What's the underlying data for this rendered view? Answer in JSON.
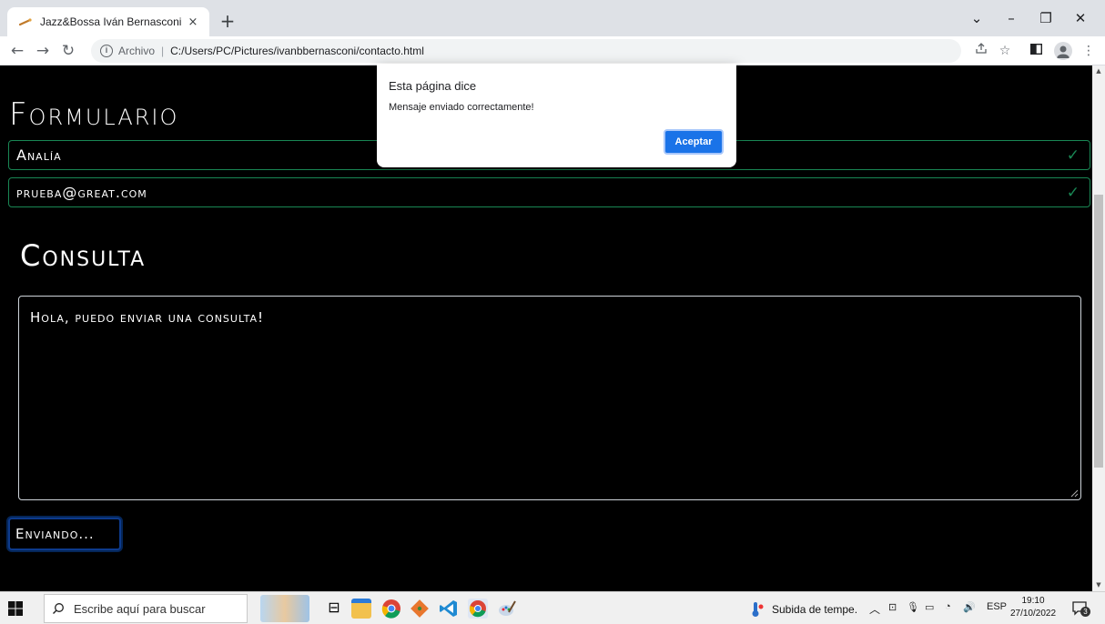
{
  "browser": {
    "tab_title": "Jazz&Bossa Iván Bernasconi",
    "tab_close": "×",
    "new_tab": "+",
    "scheme_label": "Archivo",
    "separator": "|",
    "url": "C:/Users/PC/Pictures/ivanbbernasconi/contacto.html",
    "window_controls": {
      "menu": "⌄",
      "minimize": "–",
      "restore": "❐",
      "close": "✕"
    }
  },
  "page": {
    "form_heading": "Formulario",
    "name_value": "Analía",
    "email_value": "prueba@great.com",
    "query_heading": "Consulta",
    "message_value": "Hola, puedo enviar una consulta!",
    "submit_label": "Enviando...",
    "valid_mark": "✓"
  },
  "dialog": {
    "title": "Esta página dice",
    "message": "Mensaje enviado correctamente!",
    "ok_label": "Aceptar"
  },
  "taskbar": {
    "search_placeholder": "Escribe aquí para buscar",
    "weather_text": "Subida de tempe.",
    "language": "ESP",
    "time": "19:10",
    "date": "27/10/2022",
    "notification_count": "3"
  },
  "colors": {
    "valid_border": "#198754",
    "dialog_button": "#1a73e8",
    "page_background": "#000000"
  }
}
